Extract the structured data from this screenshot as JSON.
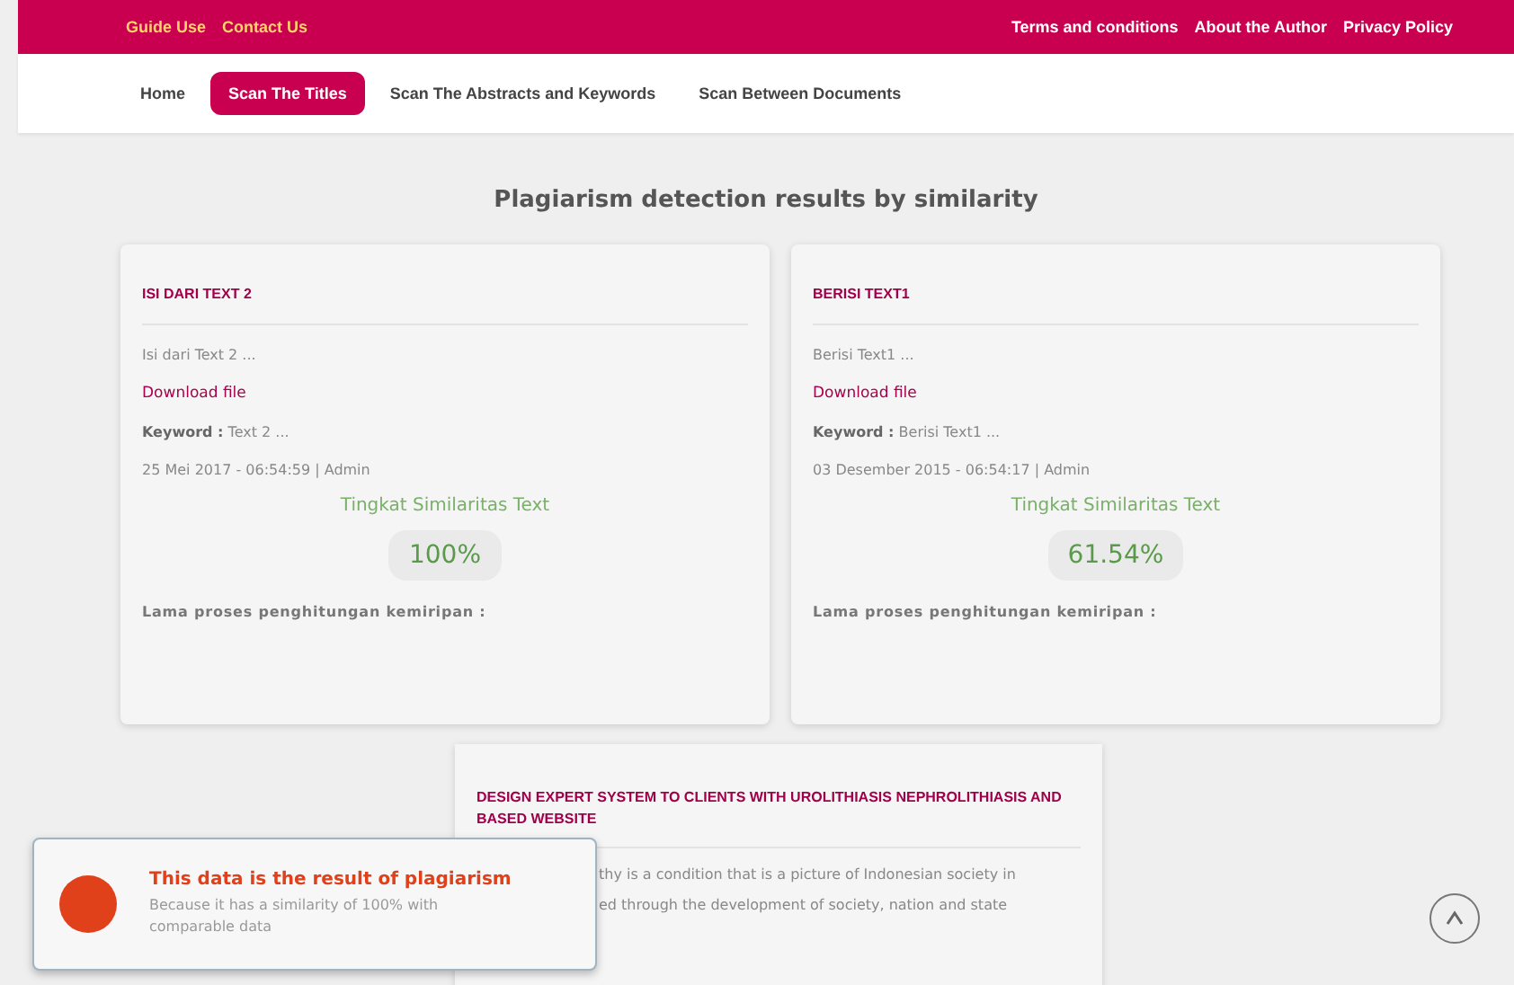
{
  "top_bar": {
    "left_links": [
      "Guide Use",
      "Contact Us"
    ],
    "right_links": [
      "Terms and conditions",
      "About the Author",
      "Privacy Policy"
    ]
  },
  "nav": {
    "tabs": [
      {
        "label": "Home",
        "selected": false
      },
      {
        "label": "Scan The Titles",
        "selected": true
      },
      {
        "label": "Scan The Abstracts and Keywords",
        "selected": false
      },
      {
        "label": "Scan Between Documents",
        "selected": false
      }
    ]
  },
  "heading": "Plagiarism detection results by similarity",
  "results": [
    {
      "title": "ISI DARI TEXT 2",
      "excerpt": "Isi dari Text 2 ...",
      "download": "Download file",
      "keyword_label": "Keyword :",
      "keyword": "Text 2 ...",
      "meta": "25 Mei 2017 - 06:54:59 | Admin",
      "similarity_label": "Tingkat Similaritas Text",
      "similarity": "100%",
      "duration_label": "Lama proses penghitungan kemiripan :"
    },
    {
      "title": "BERISI TEXT1",
      "excerpt": "Berisi Text1 ...",
      "download": "Download file",
      "keyword_label": "Keyword :",
      "keyword": "Berisi Text1 ...",
      "meta": "03 Desember 2015 - 06:54:17 | Admin",
      "similarity_label": "Tingkat Similaritas Text",
      "similarity": "61.54%",
      "duration_label": "Lama proses penghitungan kemiripan :"
    }
  ],
  "source_card": {
    "title": "DESIGN EXPERT SYSTEM TO CLIENTS WITH UROLITHIASIS NEPHROLITHIASIS AND BASED WEBSITE",
    "visible_lines": [
      "thy is a condition that is a picture of Indonesian society in",
      "ed through the development of society, nation and state"
    ]
  },
  "toast": {
    "title": "This data is the result of plagiarism",
    "message": "Because it has a similarity of 100% with comparable data",
    "color": "#e0401a"
  }
}
